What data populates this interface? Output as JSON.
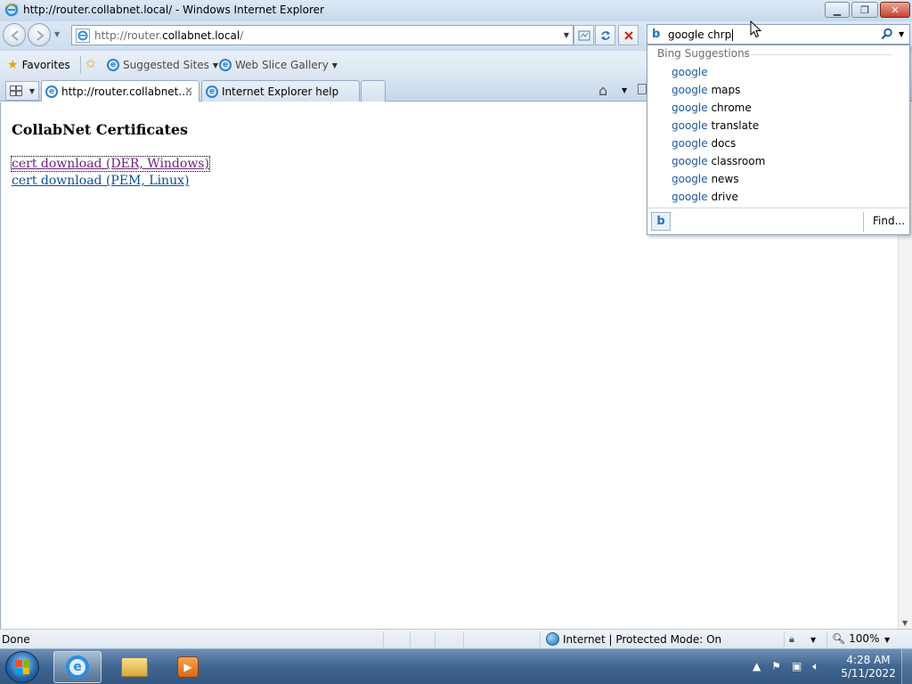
{
  "window": {
    "title": "http://router.collabnet.local/ - Windows Internet Explorer",
    "minimize": "▁",
    "maximize": "❐",
    "close": "✕"
  },
  "navbar": {
    "address_prefix": "http://router.",
    "address_domain": "collabnet.local",
    "address_suffix": "/",
    "refresh_icon": "refresh-icon",
    "stop_icon": "stop-icon"
  },
  "search": {
    "query": "google chrp",
    "provider": "b"
  },
  "favorites_bar": {
    "favorites_label": "Favorites",
    "suggested_sites_label": "Suggested Sites",
    "web_slice_label": "Web Slice Gallery"
  },
  "tabs": [
    {
      "label": "http://router.collabnet....",
      "active": true
    },
    {
      "label": "Internet Explorer help",
      "active": false
    }
  ],
  "content": {
    "heading": "CollabNet Certificates",
    "links": [
      {
        "label": "cert download (DER, Windows)",
        "visited": true
      },
      {
        "label": "cert download (PEM, Linux)",
        "visited": false
      }
    ]
  },
  "suggestions": {
    "header": "Bing Suggestions",
    "items": [
      {
        "prefix": "google",
        "rest": ""
      },
      {
        "prefix": "google",
        "rest": " maps"
      },
      {
        "prefix": "google",
        "rest": " chrome"
      },
      {
        "prefix": "google",
        "rest": " translate"
      },
      {
        "prefix": "google",
        "rest": " docs"
      },
      {
        "prefix": "google",
        "rest": " classroom"
      },
      {
        "prefix": "google",
        "rest": " news"
      },
      {
        "prefix": "google",
        "rest": " drive"
      }
    ],
    "find_label": "Find..."
  },
  "statusbar": {
    "status": "Done",
    "zone": "Internet | Protected Mode: On",
    "zoom": "100%"
  },
  "taskbar": {
    "time": "4:28 AM",
    "date": "5/11/2022"
  },
  "colors": {
    "visited_link": "#6b1f7d",
    "link": "#0b4f9c",
    "suggestion_highlight": "#1e5aa0"
  }
}
